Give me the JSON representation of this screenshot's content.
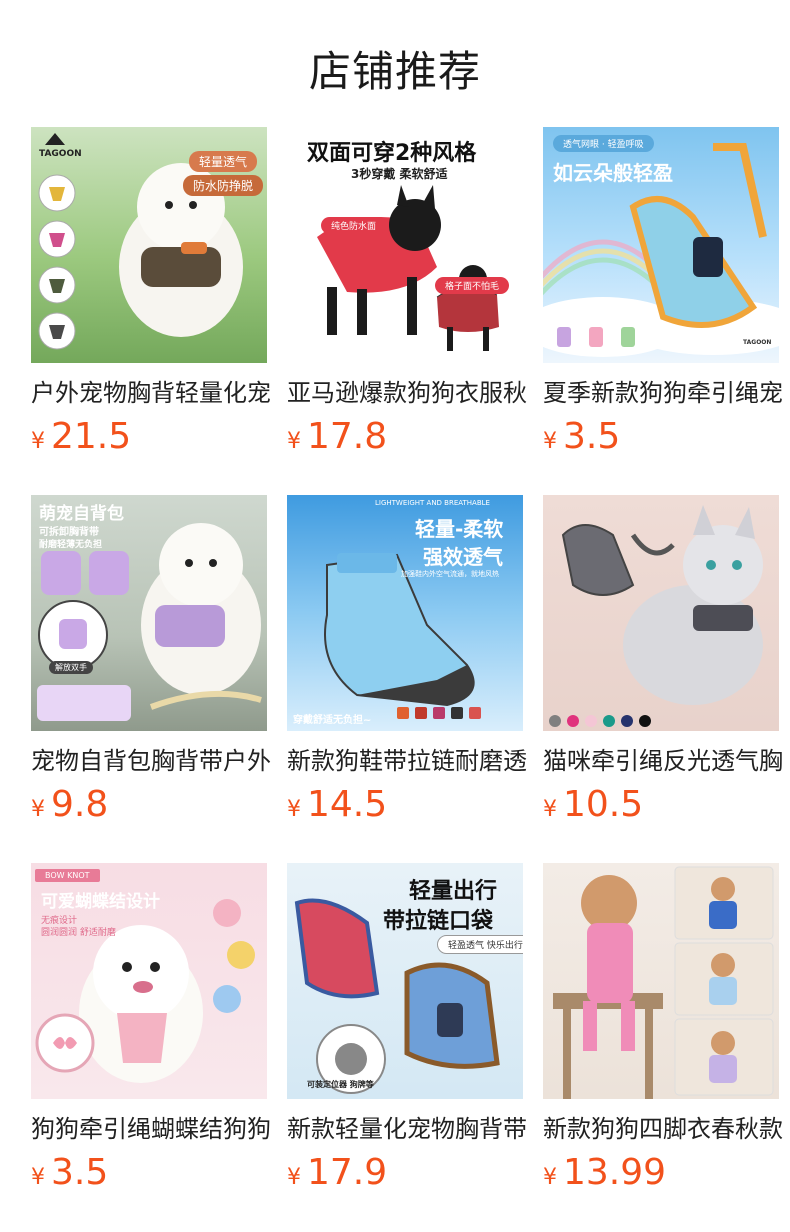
{
  "header": {
    "title": "店铺推荐"
  },
  "products": [
    {
      "name": "户外宠物胸背轻量化宠物牵引绳",
      "price": "21.5",
      "currency": "¥",
      "image_text": {
        "brand": "TAGOON",
        "badge1": "轻量透气",
        "badge2": "防水防挣脱"
      }
    },
    {
      "name": "亚马逊爆款狗狗衣服秋冬",
      "price": "17.8",
      "currency": "¥",
      "image_text": {
        "headline": "双面可穿2种风格",
        "sub": "3秒穿戴 柔软舒适",
        "tag1": "纯色防水面",
        "tag2": "格子面不怕毛"
      }
    },
    {
      "name": "夏季新款狗狗牵引绳宠物胸背",
      "price": "3.5",
      "currency": "¥",
      "image_text": {
        "top": "透气网眼 · 轻盈呼吸",
        "headline": "如云朵般轻盈",
        "brand": "TAGOON"
      }
    },
    {
      "name": "宠物自背包胸背带户外出行",
      "price": "9.8",
      "currency": "¥",
      "image_text": {
        "headline": "萌宠自背包",
        "sub1": "可拆卸胸背带",
        "sub2": "耐磨轻薄无负担",
        "tag": "解放双手"
      }
    },
    {
      "name": "新款狗鞋带拉链耐磨透气",
      "price": "14.5",
      "currency": "¥",
      "image_text": {
        "top": "LIGHTWEIGHT AND BREATHABLE",
        "headline1": "轻量-柔软",
        "headline2": "强效透气",
        "sub": "加强鞋内外空气流通，就地风热",
        "bottom": "穿戴舒适无负担~"
      }
    },
    {
      "name": "猫咪牵引绳反光透气胸背",
      "price": "10.5",
      "currency": "¥",
      "image_text": {}
    },
    {
      "name": "狗狗牵引绳蝴蝶结狗狗胸背",
      "price": "3.5",
      "currency": "¥",
      "image_text": {
        "top": "BOW KNOT",
        "headline": "可爱蝴蝶结设计",
        "sub1": "无痕设计",
        "sub2": "圆润圆润 舒适耐磨"
      }
    },
    {
      "name": "新款轻量化宠物胸背带拉链口袋",
      "price": "17.9",
      "currency": "¥",
      "image_text": {
        "headline1": "轻量出行",
        "headline2": "带拉链口袋",
        "sub": "轻盈透气 快乐出行",
        "bottom": "可装定位器 狗牌等"
      }
    },
    {
      "name": "新款狗狗四脚衣春秋款",
      "price": "13.99",
      "currency": "¥",
      "image_text": {}
    }
  ]
}
